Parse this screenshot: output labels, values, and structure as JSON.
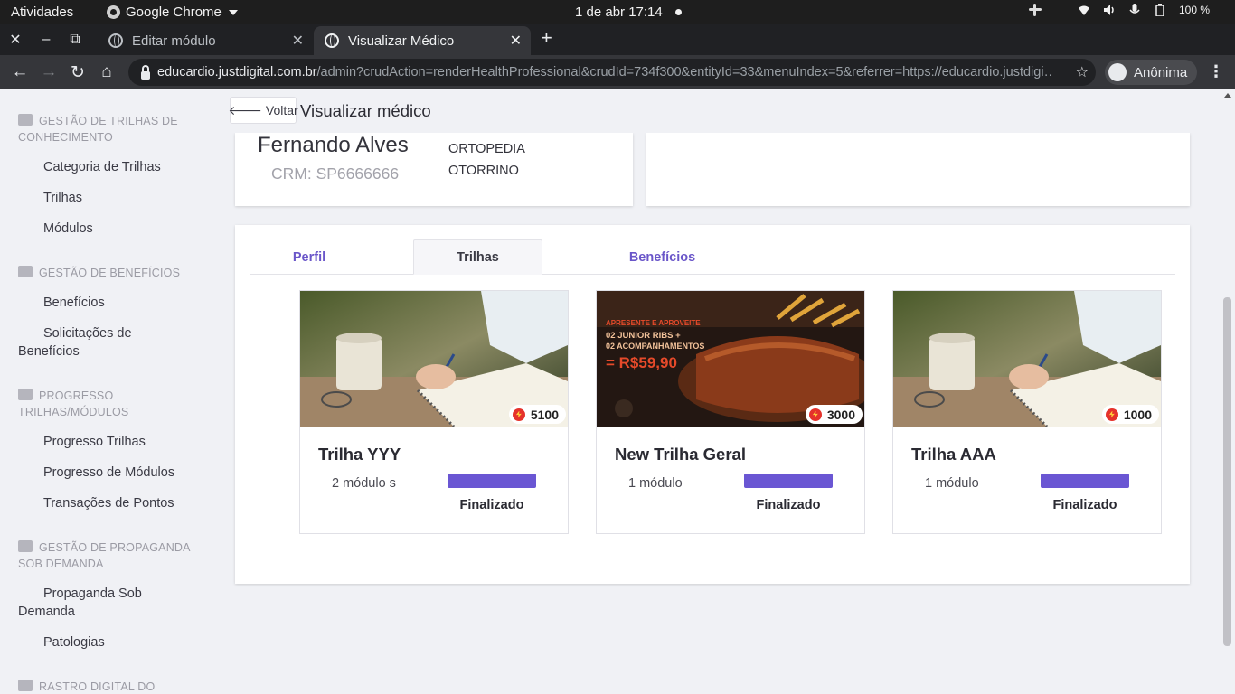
{
  "os_bar": {
    "activities": "Atividades",
    "app_name": "Google Chrome",
    "clock": "1 de abr  17:14",
    "battery": "100 %"
  },
  "browser": {
    "tabs": [
      {
        "label": "Editar módulo",
        "active": false
      },
      {
        "label": "Visualizar Médico",
        "active": true
      }
    ],
    "url_host": "educardio.justdigital.com.br",
    "url_path": "/admin?crudAction=renderHealthProfessional&crudId=734f300&entityId=33&menuIndex=5&referrer=https://educardio.justdigi…",
    "profile_label": "Anônima"
  },
  "sidebar": {
    "sections": [
      {
        "title": "GESTÃO DE TRILHAS DE CONHECIMENTO",
        "items": [
          "Categoria de Trilhas",
          "Trilhas",
          "Módulos"
        ]
      },
      {
        "title": "GESTÃO DE BENEFÍCIOS",
        "items": [
          "Benefícios",
          "Solicitações de Benefícios"
        ]
      },
      {
        "title": "PROGRESSO TRILHAS/MÓDULOS",
        "items": [
          "Progresso Trilhas",
          "Progresso de Módulos",
          "Transações de Pontos"
        ]
      },
      {
        "title": "GESTÃO DE PROPAGANDA SOB DEMANDA",
        "items": [
          "Propaganda Sob Demanda",
          "Patologias"
        ]
      },
      {
        "title": "RASTRO DIGITAL DO",
        "items": []
      }
    ]
  },
  "header": {
    "back_label": "Voltar",
    "title": "Visualizar médico"
  },
  "doctor": {
    "name": "Fernando Alves",
    "crm": "CRM: SP6666666",
    "specialties": [
      "ORTOPEDIA",
      "OTORRINO"
    ]
  },
  "profile_tabs": [
    {
      "label": "Perfil",
      "active": false
    },
    {
      "label": "Trilhas",
      "active": true
    },
    {
      "label": "Benefícios",
      "active": false
    }
  ],
  "trails": [
    {
      "title": "Trilha YYY",
      "points": "5100",
      "modules": "2 módulo s",
      "status": "Finalizado",
      "image": "notebook-writing",
      "progress": 1.0
    },
    {
      "title": "New Trilha Geral",
      "points": "3000",
      "modules": "1 módulo",
      "status": "Finalizado",
      "image": "ribs-promo",
      "progress": 1.0
    },
    {
      "title": "Trilha AAA",
      "points": "1000",
      "modules": "1 módulo",
      "status": "Finalizado",
      "image": "notebook-writing",
      "progress": 1.0
    }
  ],
  "promo_image": {
    "line1": "APRESENTE E APROVEITE",
    "line2": "02 JUNIOR RIBS +",
    "line3": "02 ACOMPANHAMENTOS",
    "price": "= R$59,90"
  },
  "colors": {
    "accent": "#6a56d3",
    "tab_link": "#6a56c9",
    "points_icon": "#e5322b"
  }
}
